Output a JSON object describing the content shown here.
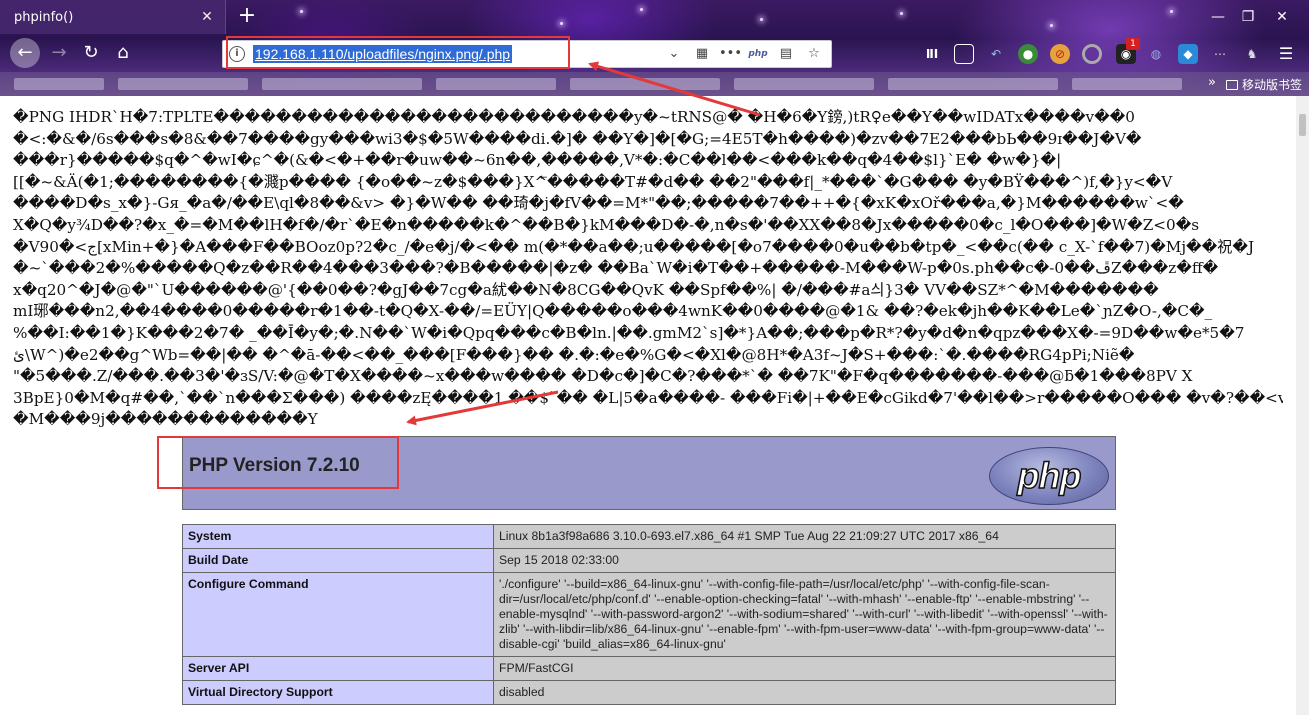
{
  "browser": {
    "tab_title": "phpinfo()",
    "tab_close": "✕",
    "new_tab": "+",
    "url": "192.168.1.110/uploadfiles/nginx.png/.php",
    "url_info_icon": "info-icon",
    "php_extension_label": "php",
    "extension_badge_count": "1",
    "bookmarks_more": "»",
    "mobile_bookmarks": "移动版书签",
    "window_controls": [
      "—",
      "❐",
      "✕"
    ],
    "colors": {
      "url_selection": "#2e6bd6",
      "annotation_red": "#e23a3a"
    }
  },
  "page": {
    "binary_lines": [
      "�PNG  IHDR`H�7:TPLTE���������������������������y�~tRNS@�  �H�6�Y鎊,)tR♀e��Y��wIDATx����v��0",
      "�<:�&�/6s���s�8&��7����gy���wi3�$�5W����di.�]�  ��Y�]�[�G;=4E5T�h����)�zv��7E2���bЬ��9ɪ��J�V�",
      "���r}�����$q�^�wI�ɕ^�(&�<�+��r�uw��~6n��,�����,V*�:�C��l��<���k��q�4��$l}`E�  �w�}�|",
      "[[�~&Ä(�1;��������{�濺p���� {�o��~z�$���}X^⃖�����T#�d��  ��2\"���f|_*���`�G���  �y�BŸ���^)f,�}y<�V",
      "����D�s_x�}-Gя_�a�/��E\\ql�8��&v>  �}�W��  ��琦�j�fV��=M*\"��;�����7��++�{�xK�xOř���a,�}M������w`<�",
      "X�Q�y¾D��?�x_�=�M��lH�f�/�r`�E�n�����k�^��B�}kM���D�-�,n�s�'��XX��8�Jx�����0�c_l�O���]�W�Z<0�ѕ",
      "�V90�<ج[xMin+�}�A���F��BOoz0p?2�c_/�e�j/�<��  m(�*��a��;u�����[�o7����0�u��b�tp�_<��c(�� c_X-`f��7)�Mj��祝�J",
      "�~`���2�%�����Q�z��R��4���3���?�B�����|�z�  ��Ba`W�i�T��+�����-M���W-p�0ѕ.ph��c�-0��ڦZ���z�ff�",
      "x�q20^�J�@�\"`U������@'{��0��?�gJ��7cg�a紌��N�8CG��QvK ��Spf��%|  �/���#a싀}3� VV��SZ*^�M�������",
      "mI琊���n2,��4����0�����r�1��-t�Q�X-��/=EÜY|Q�����o���4wnK��0����@�1& ��?�ek�jh��K��Le�`ɲZ�O-,�C�_",
      "%��I:��1�}K���2�7� _��Ī�y�;�.N��`W�i�Qpq���c�B�ln.|��.gmM2`s]�*}A��;���p�R*?�y�d�n�qpz���X�-=9D��w�e*5�7",
      "ئ\\W^)�e2��g^Wb=��|��  �^�ā-��<��_���[F���}��  �.�:�e�%G�<�Xl�@8H*�A3f~J�S+���:`�.����RG4pPi;Niẽ�",
      "\"�5���.Z/���.��3�'�ɜS/V:�@�T�X����~x���w����  �D�c�]�C�?���*`�  ��7K\"�F�q�������-���@ƃ�1���8PV X",
      "3BpE}0�M�q#��,`��`n���Σ���)  ����zĘ����1.��$`��  �L|5�a����-  ���Fi�|+��E�cGikd�7'��l��>r�����O���  �v�?��<veä",
      "�M���9j�������������Y"
    ],
    "php_version": "PHP Version 7.2.10",
    "php_logo_text": "php",
    "info_rows": [
      {
        "key": "System",
        "value": "Linux 8b1a3f98a686 3.10.0-693.el7.x86_64 #1 SMP Tue Aug 22 21:09:27 UTC 2017 x86_64"
      },
      {
        "key": "Build Date",
        "value": "Sep 15 2018 02:33:00"
      },
      {
        "key": "Configure Command",
        "value": "'./configure' '--build=x86_64-linux-gnu' '--with-config-file-path=/usr/local/etc/php' '--with-config-file-scan-dir=/usr/local/etc/php/conf.d' '--enable-option-checking=fatal' '--with-mhash' '--enable-ftp' '--enable-mbstring' '--enable-mysqlnd' '--with-password-argon2' '--with-sodium=shared' '--with-curl' '--with-libedit' '--with-openssl' '--with-zlib' '--with-libdir=lib/x86_64-linux-gnu' '--enable-fpm' '--with-fpm-user=www-data' '--with-fpm-group=www-data' '--disable-cgi' 'build_alias=x86_64-linux-gnu'"
      },
      {
        "key": "Server API",
        "value": "FPM/FastCGI"
      },
      {
        "key": "Virtual Directory Support",
        "value": "disabled"
      }
    ]
  }
}
